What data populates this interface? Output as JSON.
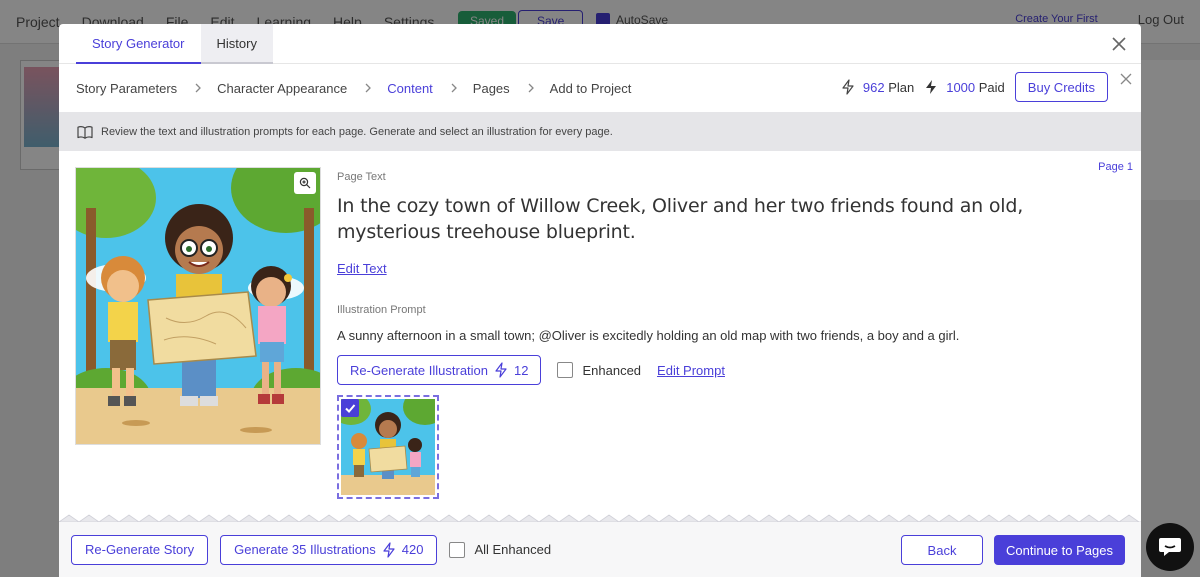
{
  "background": {
    "menu": [
      "Project",
      "Download",
      "File",
      "Edit",
      "Learning",
      "Help",
      "Settings"
    ],
    "saved_badge": "Saved",
    "save_button": "Save",
    "autosave_label": "AutoSave",
    "create_first": "Create Your First",
    "logout": "Log Out"
  },
  "modal": {
    "tabs": [
      {
        "label": "Story Generator",
        "active": true
      },
      {
        "label": "History",
        "active": false
      }
    ],
    "steps": [
      {
        "label": "Story Parameters",
        "active": false
      },
      {
        "label": "Character Appearance",
        "active": false
      },
      {
        "label": "Content",
        "active": true
      },
      {
        "label": "Pages",
        "active": false
      },
      {
        "label": "Add to Project",
        "active": false
      }
    ],
    "credits": {
      "plan_value": "962",
      "plan_label": "Plan",
      "paid_value": "1000",
      "paid_label": "Paid",
      "buy_button": "Buy Credits"
    },
    "info_text": "Review the text and illustration prompts for each page. Generate and select an illustration for every page.",
    "page": {
      "page_label": "Page 1",
      "page_text_label": "Page Text",
      "page_text": "In the cozy town of Willow Creek, Oliver and her two friends found an old, mysterious treehouse blueprint.",
      "edit_text_link": "Edit Text",
      "illustration_prompt_label": "Illustration Prompt",
      "illustration_prompt": "A sunny afternoon in a small town; @Oliver is excitedly holding an old map with two friends, a boy and a girl.",
      "regen_illustration_label": "Re-Generate Illustration",
      "regen_illustration_cost": "12",
      "enhanced_label": "Enhanced",
      "enhanced_checked": false,
      "edit_prompt_link": "Edit Prompt",
      "thumbnail_selected": true
    },
    "footer": {
      "regen_story_label": "Re-Generate Story",
      "generate_label": "Generate 35 Illustrations",
      "generate_cost": "420",
      "all_enhanced_label": "All Enhanced",
      "all_enhanced_checked": false,
      "back_label": "Back",
      "continue_label": "Continue to Pages"
    }
  },
  "colors": {
    "accent": "#4a3fd9",
    "info_bar": "#e5e5e8",
    "saved_badge": "#2fb36f"
  }
}
